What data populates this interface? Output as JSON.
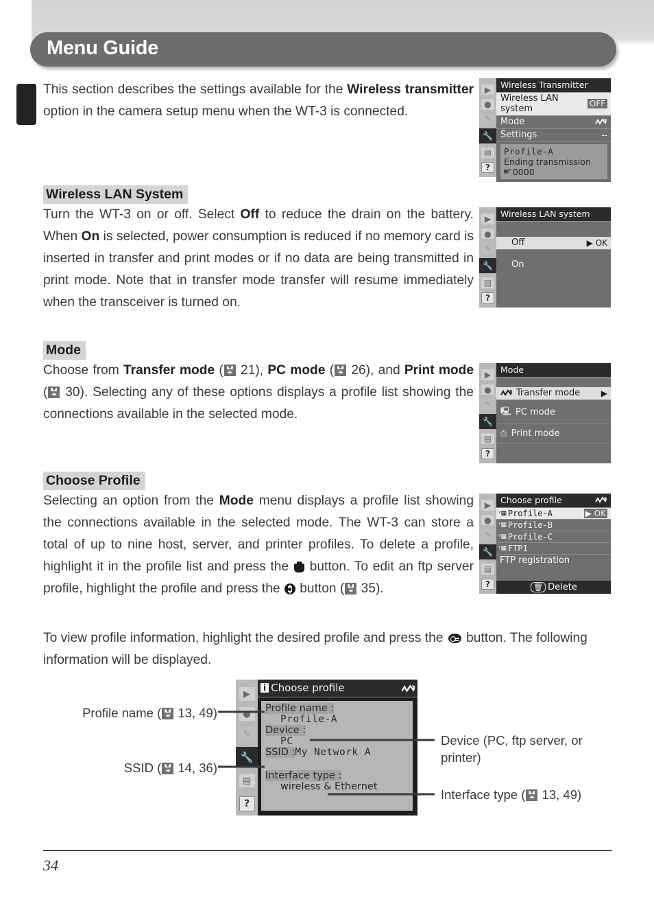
{
  "header": {
    "title": "Menu Guide"
  },
  "intro": {
    "p1_a": "This section describes the settings available for the ",
    "p1_b": "Wireless transmitter",
    "p1_c": " option in the camera setup menu when the WT-3 is connected."
  },
  "sections": [
    {
      "heading": "Wireless LAN System",
      "body_a": "Turn the WT-3 on or off.  Select ",
      "bold1": "Off",
      "body_b": " to reduce the drain on the battery.  When ",
      "bold2": "On",
      "body_c": " is selected, power consumption is reduced if no memory card is inserted in transfer and print modes or if no data are being transmitted in print mode.  Note that in transfer mode transfer will resume immediately when the transceiver is turned on."
    },
    {
      "heading": "Mode",
      "body_a": "Choose from ",
      "bold1": "Transfer mode",
      "ref1": "21",
      "mid1": "), ",
      "bold2": "PC mode",
      "ref2": "26",
      "mid2": "), and ",
      "bold3": "Print mode",
      "ref3": "30",
      "body_end": ").  Selecting any of these options displays a profile list showing the connections available in the selected mode."
    },
    {
      "heading": "Choose Profile",
      "body_a": "Selecting an option from the ",
      "bold1": "Mode",
      "body_b": " menu displays a profile list showing the connections available in the selected mode.  The WT-3 can store a total of up to nine host, server, and printer profiles.  To delete a profile, highlight it in the profile list and press the ",
      "body_c": " button.  To edit an ftp server profile, highlight the profile and press the ",
      "body_d": " button (",
      "ref1": "35",
      "body_e": ")."
    }
  ],
  "view_info": {
    "part_a": "To view profile information, highlight the desired profile and press the ",
    "part_b": " button.  The following information will be displayed."
  },
  "lcd1": {
    "title": "Wireless Transmitter",
    "rows": [
      {
        "label": "Wireless LAN system",
        "value": "OFF",
        "highlight": true
      },
      {
        "label": "Mode",
        "value": "wave-icon",
        "highlight": false
      },
      {
        "label": "Settings",
        "value": "--",
        "highlight": false
      }
    ],
    "info_line1": "Profile-A",
    "info_line2": "Ending transmission",
    "counter_icon": "remaining-icon",
    "counter": "0000",
    "rail": [
      "play-icon",
      "record-icon",
      "pencil-icon",
      "wrench-icon",
      "menu-icon",
      "help-icon"
    ]
  },
  "lcd2": {
    "title": "Wireless LAN system",
    "options": [
      {
        "label": "Off",
        "value": "▶ OK",
        "highlight": true
      },
      {
        "label": "On",
        "value": "",
        "highlight": false
      }
    ]
  },
  "lcd3": {
    "title": "Mode",
    "options": [
      {
        "icon": "wave-icon",
        "label": "Transfer mode",
        "value": "▶",
        "highlight": true
      },
      {
        "icon": "pc-icon",
        "label": "PC mode",
        "value": "",
        "highlight": false
      },
      {
        "icon": "printer-icon",
        "label": "Print mode",
        "value": "",
        "highlight": false
      }
    ]
  },
  "lcd4": {
    "title": "Choose profile",
    "title_icon": "wave-icon",
    "items": [
      {
        "icon": "antenna-lan-icon",
        "label": "Profile-A",
        "value": "▶ OK",
        "highlight": true
      },
      {
        "icon": "antenna-lan-icon",
        "label": "Profile-B",
        "value": "",
        "highlight": false
      },
      {
        "icon": "antenna-lan-icon",
        "label": "Profile-C",
        "value": "",
        "highlight": false
      },
      {
        "icon": "antenna-lan-icon",
        "label": "FTP1",
        "value": "",
        "highlight": false
      },
      {
        "icon": "",
        "label": "FTP registration",
        "value": "",
        "highlight": false
      }
    ],
    "footer_label": "Delete",
    "footer_icon": "trash-button-icon"
  },
  "lcd5": {
    "title": "Choose profile",
    "title_icon_left": "info-icon",
    "title_icon_right": "wave-icon",
    "fields": [
      {
        "label": "Profile name :",
        "value": "Profile-A"
      },
      {
        "label": "Device :",
        "value": "PC"
      },
      {
        "label": "SSID :",
        "value": "My Network A",
        "inline": true
      },
      {
        "label": "Interface type :",
        "value": "wireless & Ethernet"
      }
    ]
  },
  "callouts": {
    "profile_name": {
      "text_a": "Profile name (",
      "ref": "13, 49",
      "text_b": ")"
    },
    "ssid": {
      "text_a": "SSID (",
      "ref": "14, 36",
      "text_b": ")"
    },
    "device": {
      "text": "Device (PC, ftp server, or printer)"
    },
    "interface_type": {
      "text_a": "Interface type (",
      "ref": "13, 49",
      "text_b": ")"
    }
  },
  "footer": {
    "page_number": "34"
  }
}
